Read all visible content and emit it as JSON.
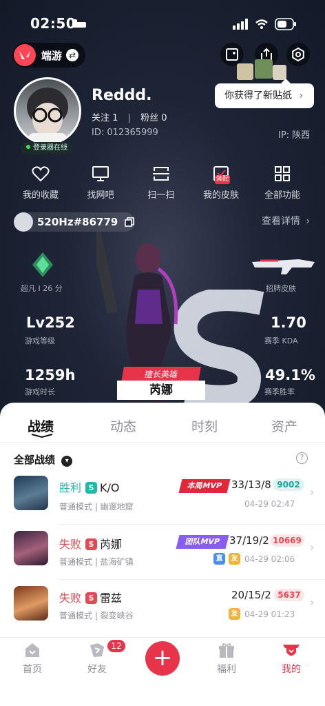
{
  "status_bar": {
    "time": "02:50"
  },
  "app": {
    "name": "端游",
    "swap_symbol": "⇄"
  },
  "tooltip": {
    "text": "你获得了新贴纸",
    "arrow": "›"
  },
  "profile": {
    "online_label": "登录器在线",
    "username": "Reddd.",
    "follow_label": "关注 1",
    "fans_label": "粉丝 0",
    "sep": "|",
    "id_label": "ID: 012365999",
    "ip_label": "IP: 陕西"
  },
  "quick_actions": [
    {
      "label": "我的收藏",
      "icon": "heart-icon"
    },
    {
      "label": "找网吧",
      "icon": "monitor-icon"
    },
    {
      "label": "扫一扫",
      "icon": "scan-icon"
    },
    {
      "label": "我的皮肤",
      "icon": "skin-icon",
      "tag": "装配"
    },
    {
      "label": "全部功能",
      "icon": "grid-icon"
    }
  ],
  "game_tag": {
    "label": "520Hz#86779"
  },
  "view_detail": "查看详情",
  "stats": {
    "rank": {
      "label": "超凡 I 26 分"
    },
    "showcase_skin": {
      "label": "招牌皮肤"
    },
    "level": {
      "value": "Lv252",
      "label": "游戏等级"
    },
    "kda": {
      "value": "1.70",
      "label": "赛季 KDA"
    },
    "hours": {
      "value": "1259h",
      "label": "游戏时长"
    },
    "winrate": {
      "value": "49.1%",
      "label": "赛季胜率"
    }
  },
  "best_hero": {
    "tag": "擅长英雄",
    "name": "芮娜"
  },
  "tabs": [
    "战绩",
    "动态",
    "时刻",
    "资产"
  ],
  "records_header": {
    "label": "全部战绩",
    "help": "?"
  },
  "matches": [
    {
      "result": "胜利",
      "result_color": "#21b8a7",
      "mode_badge": "S",
      "badge_color": "#21b8a7",
      "agent": "K/O",
      "mvp": "本局MVP",
      "mvp_color": "#e0283a",
      "score": "33/13/8",
      "points": "9002",
      "points_bg": "#dff3f3",
      "points_color": "#21a0a0",
      "mode": "普通模式 | 幽邃地窟",
      "date": "04-29 02:47",
      "extras": []
    },
    {
      "result": "失败",
      "result_color": "#e24a55",
      "mode_badge": "S",
      "badge_color": "#e24a55",
      "agent": "芮娜",
      "mvp": "团队MVP",
      "mvp_color": "#8a5cf0",
      "score": "37/19/2",
      "points": "10669",
      "points_bg": "#fde6e6",
      "points_color": "#e24a55",
      "mode": "普通模式 | 盐海矿镇",
      "date": "04-29 02:06",
      "extras": [
        "直",
        "友"
      ]
    },
    {
      "result": "失败",
      "result_color": "#e24a55",
      "mode_badge": "S",
      "badge_color": "#e24a55",
      "agent": "雷兹",
      "mvp": "",
      "mvp_color": "",
      "score": "20/15/2",
      "points": "5637",
      "points_bg": "#fde6e6",
      "points_color": "#e24a55",
      "mode": "普通模式 | 裂变峡谷",
      "date": "04-29 01:23",
      "extras": [
        "友"
      ]
    }
  ],
  "bottom_nav": [
    {
      "label": "首页",
      "icon": "home-icon"
    },
    {
      "label": "好友",
      "icon": "friends-icon",
      "badge": "12"
    },
    {
      "label": "",
      "icon": "plus-icon",
      "symbol": "+"
    },
    {
      "label": "福利",
      "icon": "gift-icon"
    },
    {
      "label": "我的",
      "icon": "profile-icon"
    }
  ],
  "colors": {
    "accent": "#e8344a",
    "win": "#21b8a7",
    "loss": "#e24a55"
  }
}
